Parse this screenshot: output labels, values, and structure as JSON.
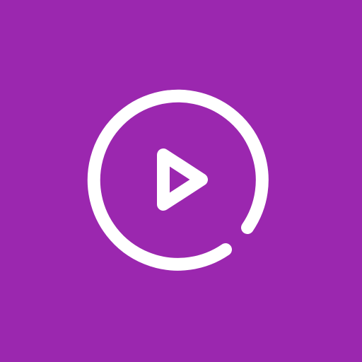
{
  "icon": {
    "name": "play-circle-icon",
    "background_color": "#9B27AF",
    "foreground_color": "#FFFFFF"
  }
}
